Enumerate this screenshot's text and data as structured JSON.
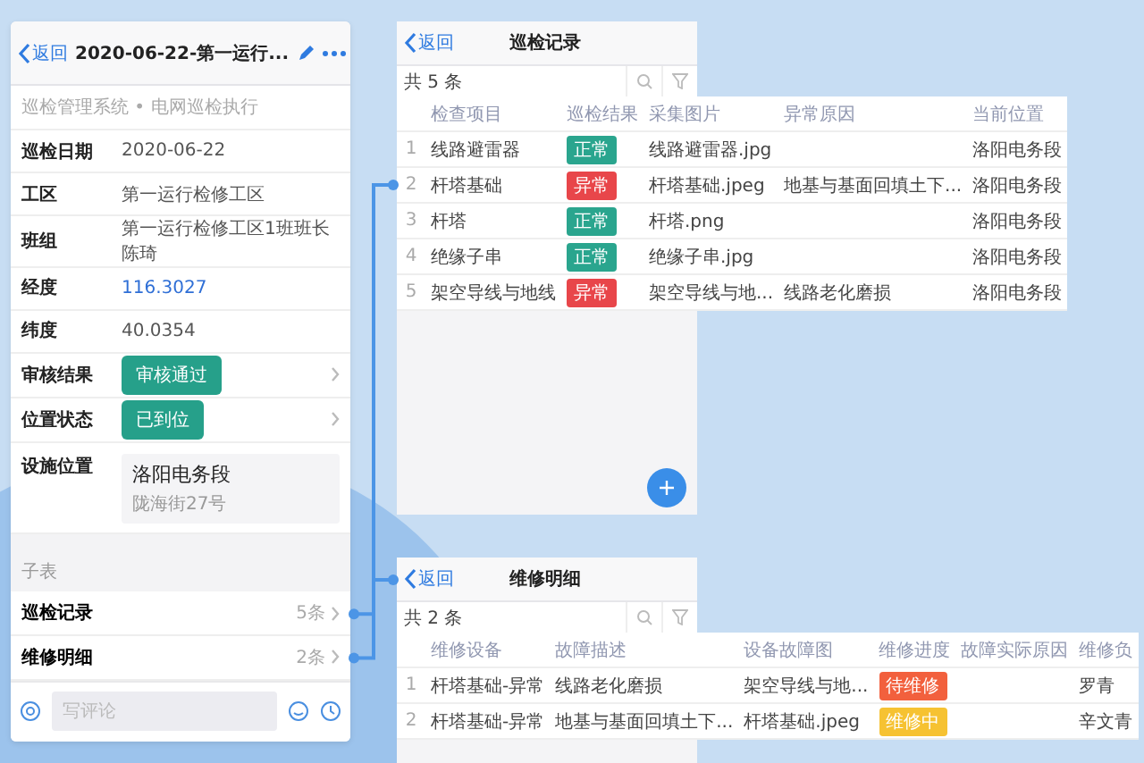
{
  "phone": {
    "back": "返回",
    "title": "2020-06-22-第一运行...",
    "breadcrumb": "巡检管理系统 • 电网巡检执行",
    "fields": [
      {
        "kind": "text",
        "label": "巡检日期",
        "value": "2020-06-22"
      },
      {
        "kind": "text",
        "label": "工区",
        "value": "第一运行检修工区"
      },
      {
        "kind": "text",
        "label": "班组",
        "value": "第一运行检修工区1班班长陈琦"
      },
      {
        "kind": "link",
        "label": "经度",
        "value": "116.3027"
      },
      {
        "kind": "text",
        "label": "纬度",
        "value": "40.0354"
      },
      {
        "kind": "tag",
        "label": "审核结果",
        "value": "审核通过"
      },
      {
        "kind": "tag",
        "label": "位置状态",
        "value": "已到位"
      },
      {
        "kind": "location",
        "label": "设施位置",
        "value": "洛阳电务段",
        "detail": "陇海街27号"
      }
    ],
    "subtable_label": "子表",
    "subtables": [
      {
        "label": "巡检记录",
        "count": "5条"
      },
      {
        "label": "维修明细",
        "count": "2条"
      }
    ],
    "comment": {
      "placeholder": "写评论"
    }
  },
  "panels": [
    {
      "back": "返回",
      "title": "巡检记录",
      "count": "共 5 条",
      "fab": true,
      "columns": [
        "",
        "检查项目",
        "巡检结果",
        "采集图片",
        "异常原因",
        "当前位置"
      ],
      "rows": [
        [
          "1",
          "线路避雷器",
          {
            "text": "正常",
            "color": "#2aa58e"
          },
          "线路避雷器.jpg",
          null,
          "洛阳电务段"
        ],
        [
          "2",
          "杆塔基础",
          {
            "text": "异常",
            "color": "#e8464a"
          },
          "杆塔基础.jpeg",
          "地基与基面回填土下...",
          "洛阳电务段"
        ],
        [
          "3",
          "杆塔",
          {
            "text": "正常",
            "color": "#2aa58e"
          },
          "杆塔.png",
          null,
          "洛阳电务段"
        ],
        [
          "4",
          "绝缘子串",
          {
            "text": "正常",
            "color": "#2aa58e"
          },
          "绝缘子串.jpg",
          null,
          "洛阳电务段"
        ],
        [
          "5",
          "架空导线与地线",
          {
            "text": "异常",
            "color": "#e8464a"
          },
          "架空导线与地...",
          "线路老化磨损",
          "洛阳电务段"
        ]
      ]
    },
    {
      "back": "返回",
      "title": "维修明细",
      "count": "共 2 条",
      "fab": false,
      "columns": [
        "",
        "维修设备",
        "故障描述",
        "设备故障图",
        "维修进度",
        "故障实际原因",
        "维修负"
      ],
      "rows": [
        [
          "1",
          "杆塔基础-异常",
          "线路老化磨损",
          "架空导线与地...",
          {
            "text": "待维修",
            "color": "#f2603d"
          },
          null,
          "罗青"
        ],
        [
          "2",
          "杆塔基础-异常",
          "地基与基面回填土下...",
          "杆塔基础.jpeg",
          {
            "text": "维修中",
            "color": "#f6c232"
          },
          null,
          "辛文青"
        ]
      ]
    }
  ]
}
